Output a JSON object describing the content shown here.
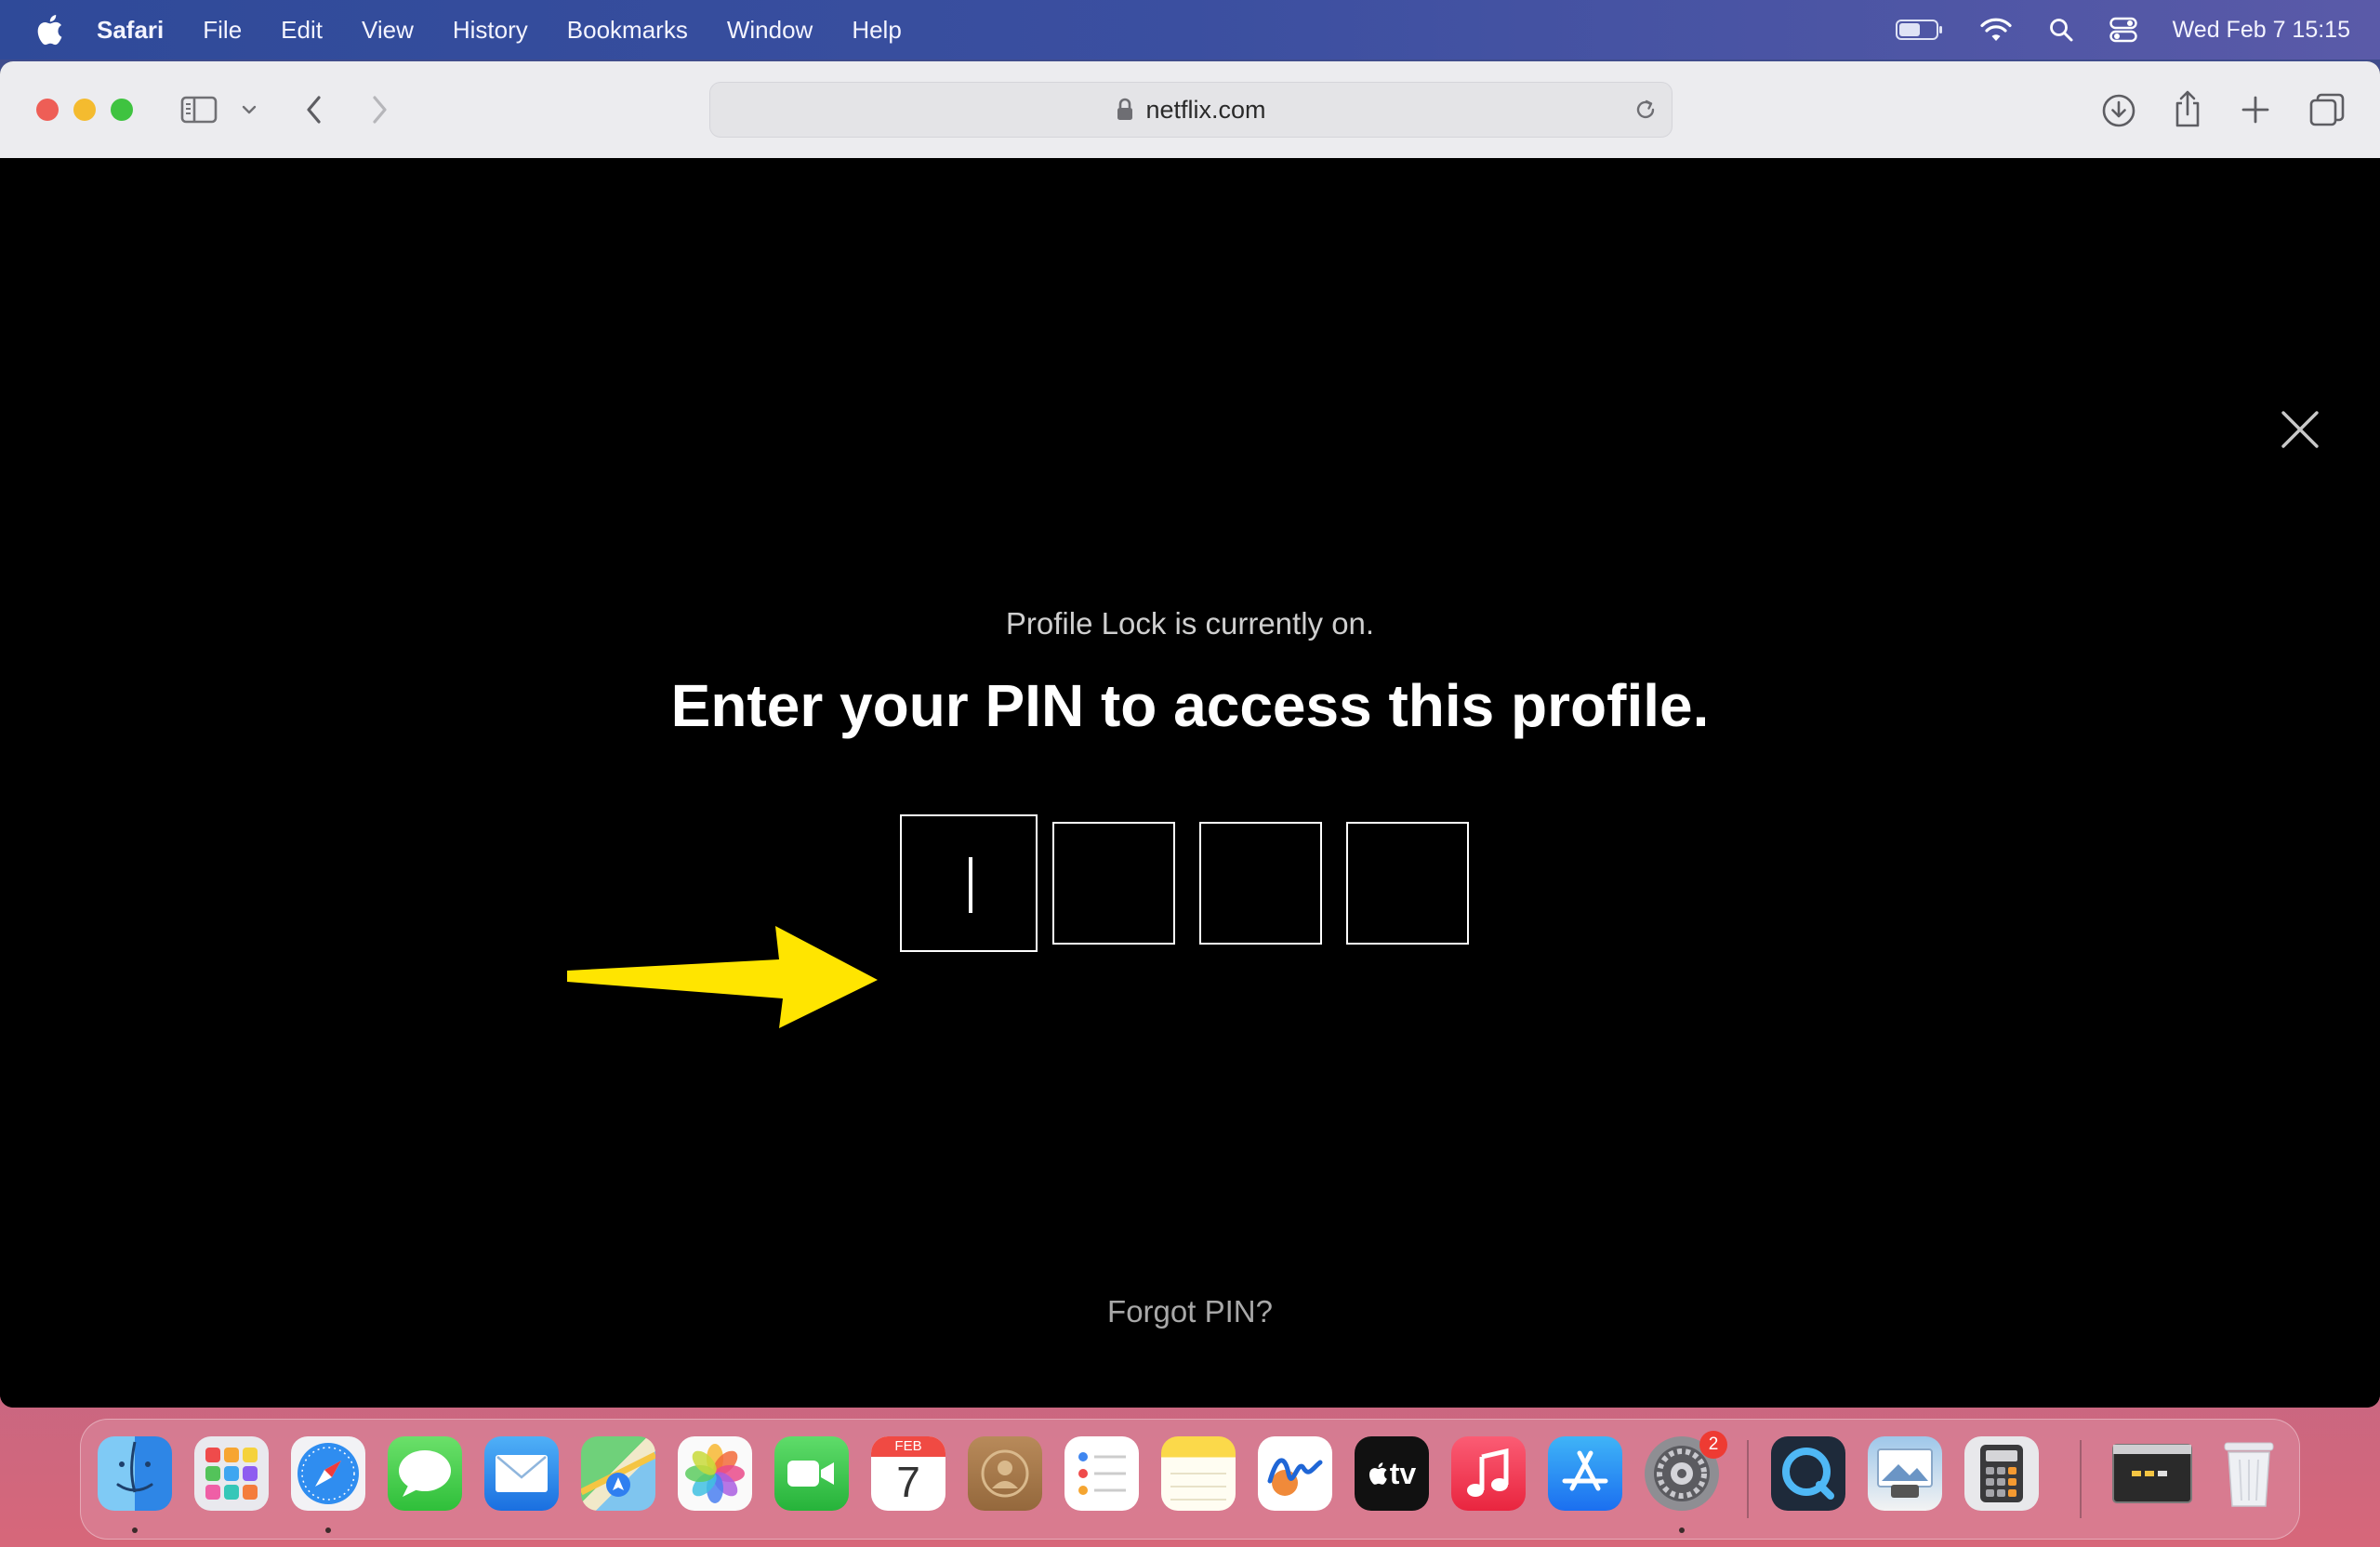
{
  "menubar": {
    "app_name": "Safari",
    "items": [
      "File",
      "Edit",
      "View",
      "History",
      "Bookmarks",
      "Window",
      "Help"
    ],
    "clock": "Wed Feb 7  15:15"
  },
  "browser": {
    "url": "netflix.com"
  },
  "page": {
    "status": "Profile Lock is currently on.",
    "headline": "Enter your PIN to access this profile.",
    "forgot": "Forgot PIN?",
    "pin_digits": 4
  },
  "dock": {
    "calendar_month": "FEB",
    "calendar_day": "7",
    "tv_label": "tv",
    "settings_badge": "2"
  },
  "colors": {
    "arrow": "#ffe500",
    "background": "#000000"
  }
}
